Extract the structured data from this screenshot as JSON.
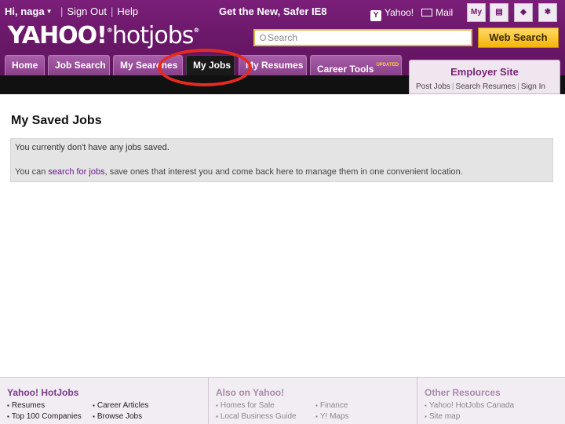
{
  "header": {
    "greeting": "Hi, naga",
    "links": [
      "Sign Out",
      "Help"
    ],
    "promo": "Get the New, Safer IE8",
    "yahoo_link": "Yahoo!",
    "mail_link": "Mail",
    "my_icon": "My",
    "logo_yahoo": "YAHOO!",
    "logo_hotjobs": "hotjobs"
  },
  "search": {
    "placeholder": "Search",
    "button": "Web Search"
  },
  "tabs": [
    {
      "label": "Home"
    },
    {
      "label": "Job Search"
    },
    {
      "label": "My Searches"
    },
    {
      "label": "My Jobs"
    },
    {
      "label": "My Resumes"
    },
    {
      "label": "Career Tools",
      "badge": "UPDATED"
    }
  ],
  "employer": {
    "title": "Employer Site",
    "links": [
      "Post Jobs",
      "Search Resumes",
      "Sign In"
    ]
  },
  "main": {
    "title": "My Saved Jobs",
    "notice_line1": "You currently don't have any jobs saved.",
    "notice_pre": "You can ",
    "notice_link": "search for jobs",
    "notice_post": ", save ones that interest you and come back here to manage them in one convenient location."
  },
  "footer": {
    "col1": {
      "heading": "Yahoo! HotJobs",
      "items": [
        "Resumes",
        "Career Articles",
        "Top 100 Companies",
        "Browse Jobs"
      ]
    },
    "col2": {
      "heading": "Also on Yahoo!",
      "items": [
        "Homes for Sale",
        "Finance",
        "Local Business Guide",
        "Y! Maps"
      ]
    },
    "col3": {
      "heading": "Other Resources",
      "items": [
        "Yahoo! HotJobs Canada",
        "Site map"
      ]
    }
  },
  "colors": {
    "brand_purple": "#6a1869",
    "highlight_circle": "#e62b1e",
    "search_button": "#f5b50a"
  }
}
